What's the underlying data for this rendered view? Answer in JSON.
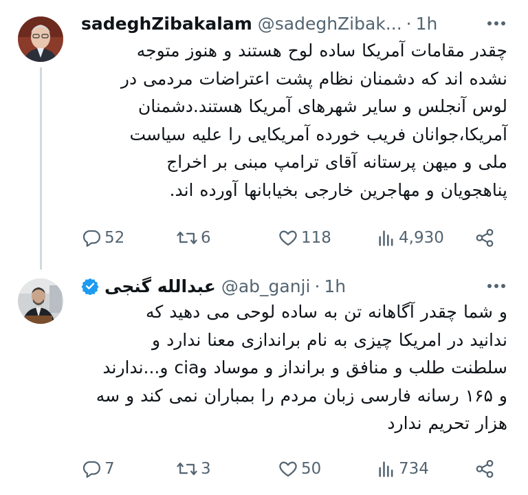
{
  "tweets": [
    {
      "author_name": "sadeghZibakalam",
      "handle": "@sadeghZibak...",
      "separator": "·",
      "time": "1h",
      "verified": false,
      "lines": [
        "چقدر مقامات آمریکا ساده لوح هستند و هنوز متوجه",
        "نشده اند که دشمنان نظام پشت اعتراضات مردمی در",
        "لوس آنجلس و سایر شهرهای آمریکا هستند.دشمنان",
        "آمریکا،جوانان فریب خورده آمریکایی را علیه سیاست",
        "ملی و میهن پرستانه  آقای ترامپ مبنی بر اخراج",
        "پناهجویان و مهاجرین خارجی بخیابانها آورده اند."
      ],
      "replies": "52",
      "retweets": "6",
      "likes": "118",
      "views": "4,930"
    },
    {
      "author_name": "عبدالله گنجی",
      "handle": "@ab_ganji",
      "separator": "·",
      "time": "1h",
      "verified": true,
      "lines": [
        "و شما چقدر آگاهانه تن به ساده لوحی می دهید که",
        "ندانید در امریکا چیزی به نام براندازی معنا ندارد و",
        "سلطنت طلب و منافق و برانداز و موساد وcia و...ندارند",
        "و ۱۶۵ رسانه فارسی زبان مردم را بمباران نمی کند و سه",
        "هزار تحریم ندارد"
      ],
      "replies": "7",
      "retweets": "3",
      "likes": "50",
      "views": "734"
    }
  ],
  "colors": {
    "text": "#0f1419",
    "muted": "#536471",
    "verified": "#1d9bf0",
    "thread_line": "#cfd9de"
  },
  "icons": [
    "reply-icon",
    "retweet-icon",
    "like-icon",
    "views-icon",
    "share-icon",
    "more-icon",
    "verified-icon"
  ]
}
